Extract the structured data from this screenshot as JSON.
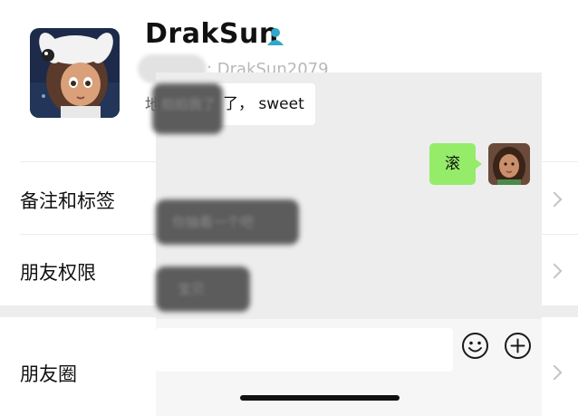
{
  "profile": {
    "name": "DrakSun",
    "wxid_visible": ": DrakSun2079",
    "region_prefix": "地",
    "gender_icon": "male-user-icon",
    "avatar_icon": "anime-girl-avatar"
  },
  "menu": {
    "remark_label": "备注和标签",
    "permission_label": "朋友权限",
    "moments_label": "朋友圈"
  },
  "chat": {
    "message_left_1_tail": "了， sweet",
    "message_left_1_blurred": "拍拍我了",
    "message_right_1": "滚",
    "message_left_2_blurred": "你抽看一个吧",
    "message_left_3_blurred": "宝贝",
    "my_avatar_icon": "girl-avatar"
  },
  "input_bar": {
    "emoji_icon": "emoji-icon",
    "plus_icon": "plus-icon"
  },
  "colors": {
    "bubble_green": "#95ec69",
    "chat_bg": "#ededed",
    "gender_icon": "#2fa8c9"
  }
}
